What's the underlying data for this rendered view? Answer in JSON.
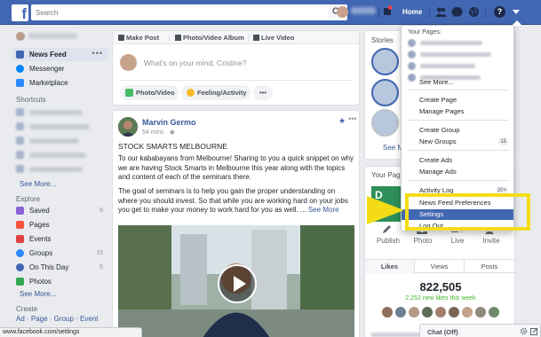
{
  "topbar": {
    "logo": "f",
    "search_placeholder": "Search",
    "home": "Home",
    "help": "?"
  },
  "leftnav": {
    "items": [
      {
        "label": "News Feed",
        "dots": "•••",
        "color": "#4267b2"
      },
      {
        "label": "Messenger",
        "color": "#0084ff"
      },
      {
        "label": "Marketplace",
        "color": "#2d88ff"
      }
    ],
    "shortcuts_head": "Shortcuts",
    "shortcuts_see_more": "See More...",
    "explore_head": "Explore",
    "explore": [
      {
        "label": "Saved",
        "count": "6",
        "color": "#8c64d8"
      },
      {
        "label": "Pages",
        "color": "#f5533d"
      },
      {
        "label": "Events",
        "color": "#e04141"
      },
      {
        "label": "Groups",
        "count": "15",
        "color": "#2d88ff"
      },
      {
        "label": "On This Day",
        "count": "5",
        "color": "#4267b2"
      },
      {
        "label": "Photos",
        "color": "#33a853"
      }
    ],
    "explore_see_more": "See More...",
    "create_head": "Create",
    "create_links": "Ad · Page · Group · Event"
  },
  "composer": {
    "tabs": [
      "Make Post",
      "Photo/Video Album",
      "Live Video"
    ],
    "placeholder": "What's on your mind, Cristine?",
    "photo_video": "Photo/Video",
    "feeling": "Feeling/Activity",
    "more": "•••"
  },
  "post": {
    "author": "Marvin Germo",
    "meta": "54 mins · ",
    "title": "STOCK SMARTS MELBOURNE",
    "p1": "To our kababayans from Melbourne! Sharing to you a quick snippet on why we are having Stock Smarts in Melbourne this year along with the topics and content of each of the seminars there.",
    "p2": "The goal of seminars is to help you gain the proper understanding on where you should invest. So that while you are working hard on your jobs you get to make your money to work hard for you as well. ...",
    "see_more": "See More",
    "more_icon": "•••"
  },
  "stories": {
    "title": "Stories",
    "see_more": "See M"
  },
  "pages": {
    "title": "Your Pages",
    "cover_text": "D\nH",
    "actions": [
      "Publish",
      "Photo",
      "Live",
      "Invite"
    ],
    "tabs": [
      "Likes",
      "Views",
      "Posts"
    ],
    "likes": "822,505",
    "new_likes": "2,252 new likes this week"
  },
  "menu": {
    "your_pages": "Your Pages:",
    "see_more": "See More...",
    "group1": [
      "Create Page",
      "Manage Pages"
    ],
    "group2": [
      "Create Group",
      "New Groups"
    ],
    "new_groups_badge": "15",
    "group3": [
      "Create Ads",
      "Manage Ads"
    ],
    "activity_log": "Activity Log",
    "activity_badge": "20+",
    "news_feed_prefs": "News Feed Preferences",
    "settings": "Settings",
    "log_out": "Log Out"
  },
  "status_bar": "www.facebook.com/settings",
  "chat": {
    "label": "Chat (Off)"
  },
  "colors": {
    "brand": "#4267b2",
    "highlight": "#f3dc15",
    "link": "#365899",
    "positive": "#42b72a"
  }
}
